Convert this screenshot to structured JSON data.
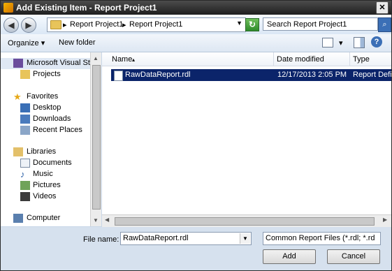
{
  "window": {
    "title": "Add Existing Item - Report Project1",
    "close_glyph": "✕"
  },
  "nav": {
    "back_glyph": "◀",
    "forward_glyph": "▶",
    "breadcrumb": [
      "Report Project1",
      "Report Project1"
    ],
    "separator": "▸",
    "refresh_glyph": "↻",
    "search_placeholder": "Search Report Project1",
    "search_icon": "⌕"
  },
  "toolbar": {
    "organize": "Organize ▾",
    "new_folder": "New folder",
    "help": "?",
    "view_arrow": "▾"
  },
  "sidebar": {
    "items": [
      {
        "label": "Microsoft Visual Stud",
        "icon": "visual-studio-icon"
      },
      {
        "label": "Projects",
        "icon": "folder-icon"
      },
      {
        "label": "Favorites",
        "icon": "star-icon"
      },
      {
        "label": "Desktop",
        "icon": "desktop-icon"
      },
      {
        "label": "Downloads",
        "icon": "downloads-icon"
      },
      {
        "label": "Recent Places",
        "icon": "recent-places-icon"
      },
      {
        "label": "Libraries",
        "icon": "libraries-icon"
      },
      {
        "label": "Documents",
        "icon": "documents-icon"
      },
      {
        "label": "Music",
        "icon": "music-icon"
      },
      {
        "label": "Pictures",
        "icon": "pictures-icon"
      },
      {
        "label": "Videos",
        "icon": "videos-icon"
      },
      {
        "label": "Computer",
        "icon": "computer-icon"
      }
    ]
  },
  "files": {
    "columns": [
      "Name",
      "Date modified",
      "Type"
    ],
    "sort_glyph": "▴",
    "rows": [
      {
        "name": "RawDataReport.rdl",
        "date": "12/17/2013 2:05 PM",
        "type": "Report Defin"
      }
    ]
  },
  "footer": {
    "file_name_label": "File name:",
    "file_name_value": "RawDataReport.rdl",
    "file_type": "Common Report Files (*.rdl; *.rd",
    "add": "Add",
    "cancel": "Cancel"
  },
  "colors": {
    "selection": "#0b246a",
    "frame": "#c9d7e8",
    "titlebar": "#2b2b2b"
  }
}
